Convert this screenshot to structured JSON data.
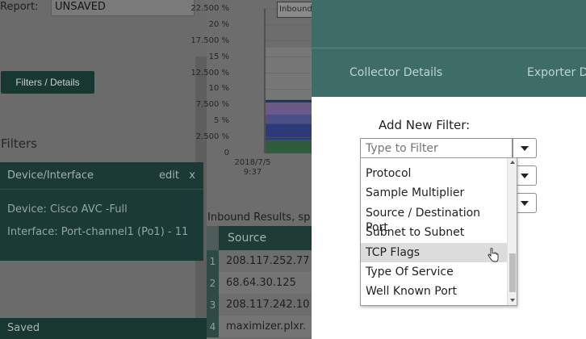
{
  "left": {
    "report_label": "Report:",
    "report_value": "UNSAVED",
    "filters_button": "Filters / Details",
    "filters_heading": "Filters",
    "device_card": {
      "title": "Device/Interface",
      "edit_label": "edit",
      "close_label": "x",
      "device_line": "Device: Cisco AVC -Full",
      "interface_line": "Interface: Port-channel1 (Po1) - 11"
    },
    "status": "Saved"
  },
  "chart_data": {
    "type": "area",
    "y_ticks": [
      "22.500 %",
      "20 %",
      "17.500 %",
      "15 %",
      "12.500 %",
      "10 %",
      "7.500 %",
      "5 %",
      "2.500 %",
      "0"
    ],
    "ylim": [
      0,
      23.5
    ],
    "x_ticks": [
      "2018/7/5 9:37"
    ],
    "legend_tab": "Inbound",
    "series": [
      {
        "values": [
          2.2
        ],
        "color": "#2e5c3c"
      },
      {
        "values": [
          2.6
        ],
        "color": "#2c3a7a"
      },
      {
        "values": [
          1.5
        ],
        "color": "#4a4f8a"
      },
      {
        "values": [
          2.0
        ],
        "color": "#6a5a8a"
      },
      {
        "values": [
          0.4
        ],
        "color": "#1f2f55"
      },
      {
        "values": [
          8.5
        ],
        "color": "#777777"
      }
    ]
  },
  "results": {
    "title": "Inbound Results, sp",
    "column_header": "Source",
    "rows": [
      {
        "index": "1",
        "source": "208.117.252.77"
      },
      {
        "index": "2",
        "source": "68.64.30.125"
      },
      {
        "index": "3",
        "source": "208.117.242.10"
      },
      {
        "index": "4",
        "source": "maximizer.plxr."
      }
    ]
  },
  "modal": {
    "tabs": [
      "Collector Details",
      "Exporter D"
    ],
    "add_filter_label": "Add New Filter:",
    "filter_placeholder": "Type to Filter",
    "dropdown_items": [
      "Protocol",
      "Sample Multiplier",
      "Source / Destination Port",
      "Subnet to Subnet",
      "TCP Flags",
      "Type Of Service",
      "Well Known Port"
    ],
    "hovered_item": "TCP Flags"
  },
  "colors": {
    "teal_header": "#3d6d66",
    "dark_teal": "#1c3a35",
    "hover": "#dcdcdc"
  }
}
